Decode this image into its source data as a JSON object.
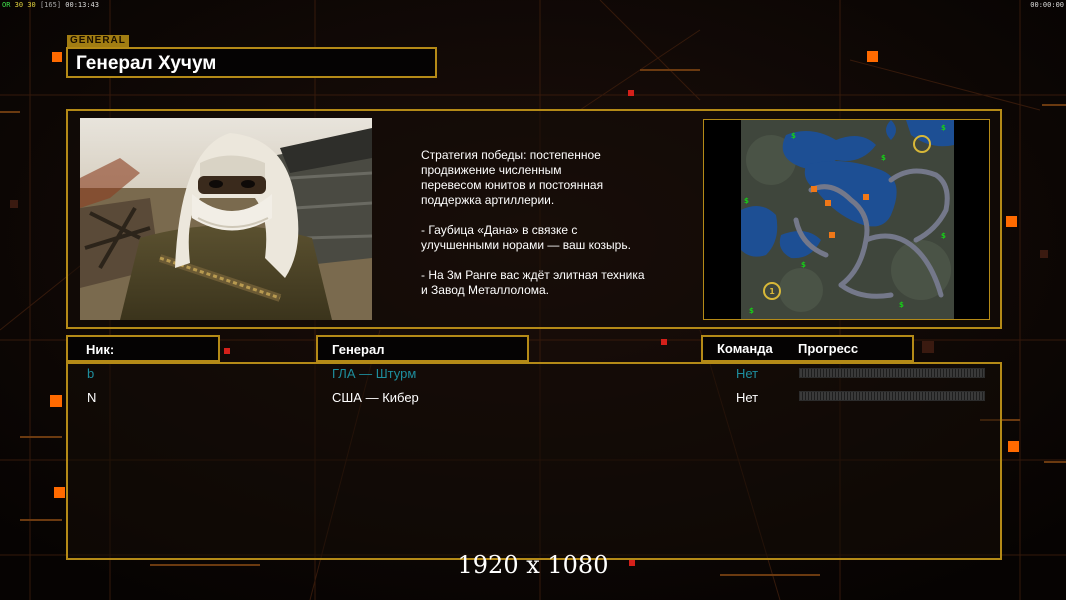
{
  "overlay": {
    "fps_label": "OR",
    "fps_value_1": "30",
    "fps_value_2": "30",
    "frame_count": "[165]",
    "elapsed_time": "00:13:43",
    "clock": "00:00:00"
  },
  "header": {
    "tag": "GENERAL",
    "title": "Генерал Хучум"
  },
  "general_info": {
    "description": "Стратегия победы: постепенное\nпродвижение численным\nперевесом юнитов и постоянная\nподдержка артиллерии.\n\n- Гаубица «Дана» в связке с\nулучшенными норами — ваш козырь.\n\n- На 3м Ранге вас ждёт элитная техника\nи Завод Металлолома."
  },
  "minimap": {
    "marker_label": "1"
  },
  "table": {
    "headers": {
      "nick": "Ник:",
      "general": "Генерал",
      "team": "Команда",
      "progress": "Прогресс"
    },
    "rows": [
      {
        "nick": "b",
        "general": "ГЛА — Штурм",
        "team": "Нет",
        "progress": 0,
        "color": "#1e8e9e"
      },
      {
        "nick": "N",
        "general": "США — Кибер",
        "team": "Нет",
        "progress": 0,
        "color": "#ffffff"
      }
    ]
  },
  "footer": {
    "resolution": "1920 x 1080"
  },
  "colors": {
    "gold_border": "#b48a17",
    "accent_orange": "#ff6a00",
    "teal_player": "#1e8e9e"
  }
}
